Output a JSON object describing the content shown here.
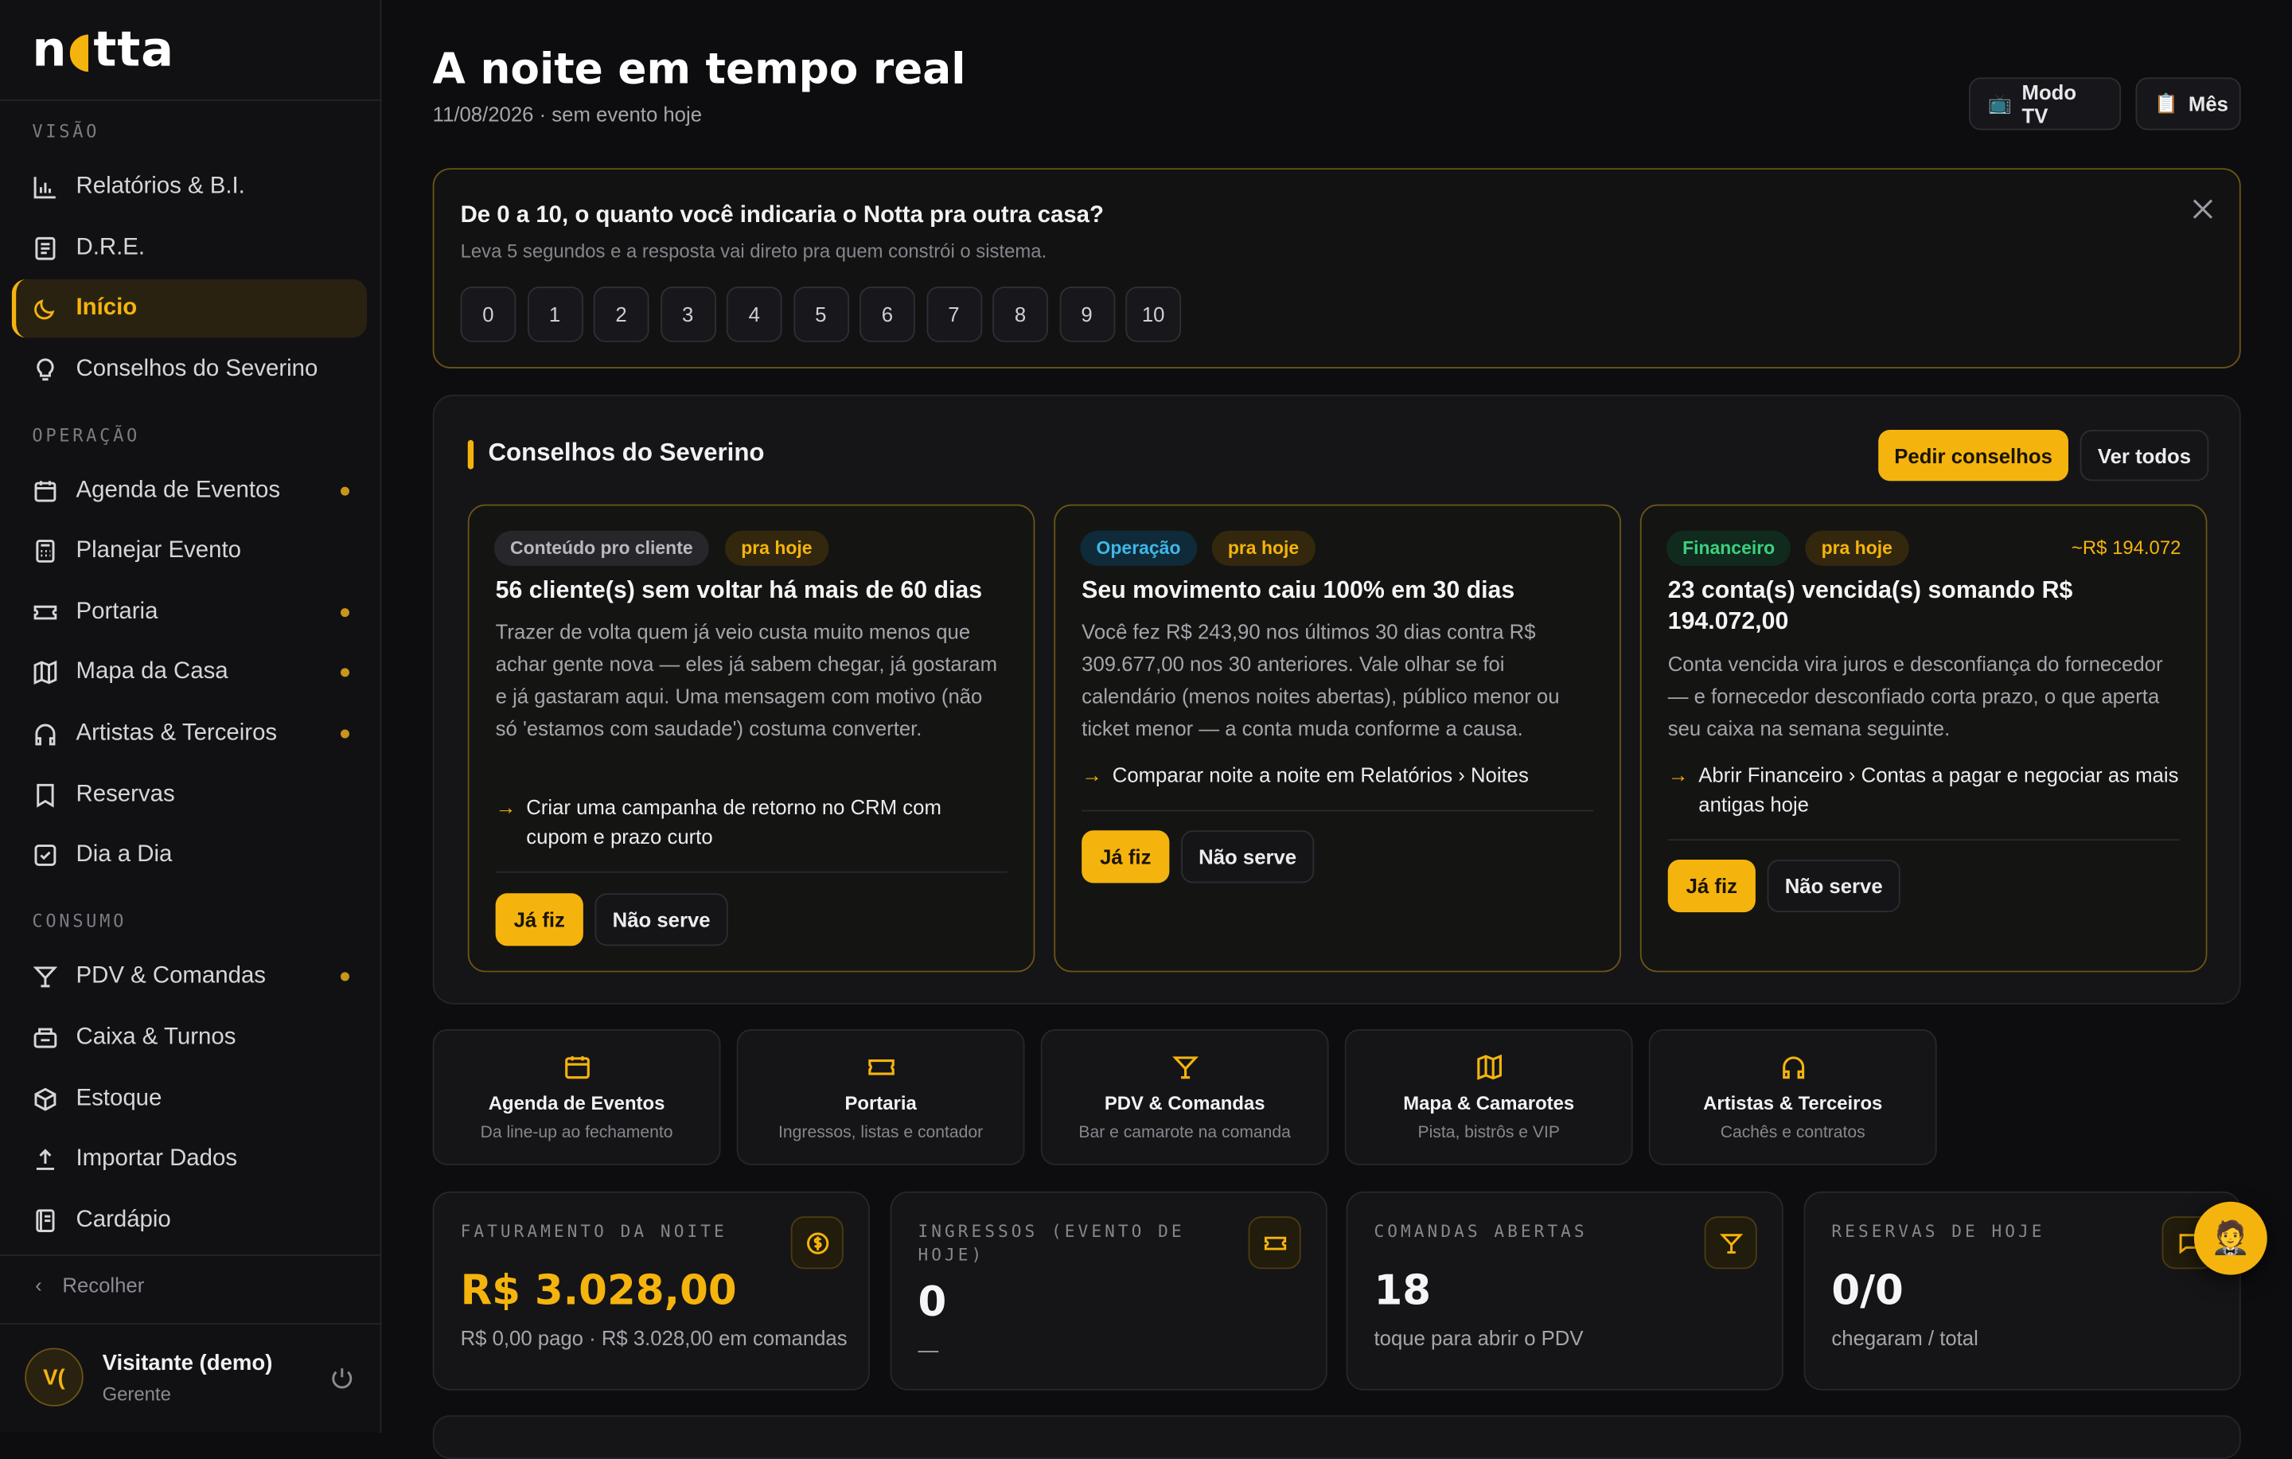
{
  "brand": {
    "logo_a": "n",
    "logo_moon": "●",
    "logo_b": "tta"
  },
  "sidebar": {
    "sections": {
      "visao": "VISÃO",
      "operacao": "OPERAÇÃO",
      "consumo": "CONSUMO"
    },
    "items": [
      {
        "label": "Relatórios & B.I.",
        "icon": "bar-chart-icon"
      },
      {
        "label": "D.R.E.",
        "icon": "document-icon"
      },
      {
        "label": "Início",
        "icon": "moon-icon",
        "active": true
      },
      {
        "label": "Conselhos do Severino",
        "icon": "lightbulb-icon"
      },
      {
        "label": "Agenda de Eventos",
        "icon": "calendar-icon",
        "dot": true
      },
      {
        "label": "Planejar Evento",
        "icon": "calculator-icon"
      },
      {
        "label": "Portaria",
        "icon": "ticket-icon",
        "dot": true
      },
      {
        "label": "Mapa da Casa",
        "icon": "map-icon",
        "dot": true
      },
      {
        "label": "Artistas & Terceiros",
        "icon": "headphones-icon",
        "dot": true
      },
      {
        "label": "Reservas",
        "icon": "bookmark-icon"
      },
      {
        "label": "Dia a Dia",
        "icon": "checkbox-icon"
      },
      {
        "label": "PDV & Comandas",
        "icon": "cocktail-icon",
        "dot": true
      },
      {
        "label": "Caixa & Turnos",
        "icon": "cash-register-icon"
      },
      {
        "label": "Estoque",
        "icon": "box-icon"
      },
      {
        "label": "Importar Dados",
        "icon": "upload-icon"
      },
      {
        "label": "Cardápio",
        "icon": "menu-book-icon"
      }
    ],
    "collapse_label": "Recolher",
    "user": {
      "initials": "V(",
      "name": "Visitante (demo)",
      "role": "Gerente"
    }
  },
  "header": {
    "title": "A noite em tempo real",
    "subtitle": "11/08/2026 · sem evento hoje",
    "btn_tv": "Modo TV",
    "btn_tv_icon": "📺",
    "btn_month": "Mês",
    "btn_month_icon": "📋"
  },
  "nps": {
    "question": "De 0 a 10, o quanto você indicaria o Notta pra outra casa?",
    "sub": "Leva 5 segundos e a resposta vai direto pra quem constrói o sistema.",
    "scores": [
      "0",
      "1",
      "2",
      "3",
      "4",
      "5",
      "6",
      "7",
      "8",
      "9",
      "10"
    ]
  },
  "advice": {
    "title": "Conselhos do Severino",
    "btn_ask": "Pedir conselhos",
    "btn_all": "Ver todos",
    "cards": [
      {
        "tag1": "Conteúdo pro cliente",
        "tag2": "pra hoje",
        "headline": "56 cliente(s) sem voltar há mais de 60 dias",
        "body": "Trazer de volta quem já veio custa muito menos que achar gente nova — eles já sabem chegar, já gostaram e já gastaram aqui. Uma mensagem com motivo (não só 'estamos com saudade') costuma converter.",
        "action": "Criar uma campanha de retorno no CRM com cupom e prazo curto",
        "done": "Já fiz",
        "dismiss": "Não serve"
      },
      {
        "tag1": "Operação",
        "tag2": "pra hoje",
        "headline": "Seu movimento caiu 100% em 30 dias",
        "body": "Você fez R$ 243,90 nos últimos 30 dias contra R$ 309.677,00 nos 30 anteriores. Vale olhar se foi calendário (menos noites abertas), público menor ou ticket menor — a conta muda conforme a causa.",
        "action": "Comparar noite a noite em Relatórios › Noites",
        "done": "Já fiz",
        "dismiss": "Não serve"
      },
      {
        "tag1": "Financeiro",
        "tag2": "pra hoje",
        "amount": "~R$ 194.072",
        "headline": "23 conta(s) vencida(s) somando R$ 194.072,00",
        "body": "Conta vencida vira juros e desconfiança do fornecedor — e fornecedor desconfiado corta prazo, o que aperta seu caixa na semana seguinte.",
        "action": "Abrir Financeiro › Contas a pagar e negociar as mais antigas hoje",
        "done": "Já fiz",
        "dismiss": "Não serve"
      }
    ]
  },
  "quick_links": [
    {
      "title": "Agenda de Eventos",
      "sub": "Da line-up ao fechamento",
      "icon": "calendar-icon"
    },
    {
      "title": "Portaria",
      "sub": "Ingressos, listas e contador",
      "icon": "ticket-icon"
    },
    {
      "title": "PDV & Comandas",
      "sub": "Bar e camarote na comanda",
      "icon": "cocktail-icon"
    },
    {
      "title": "Mapa & Camarotes",
      "sub": "Pista, bistrôs e VIP",
      "icon": "map-icon"
    },
    {
      "title": "Artistas & Terceiros",
      "sub": "Cachês e contratos",
      "icon": "headphones-icon"
    }
  ],
  "kpis": [
    {
      "label": "FATURAMENTO DA NOITE",
      "value": "R$ 3.028,00",
      "sub": "R$ 0,00 pago · R$ 3.028,00 em comandas",
      "icon": "dollar-icon"
    },
    {
      "label": "INGRESSOS (EVENTO DE HOJE)",
      "value": "0",
      "sub": "—",
      "icon": "ticket-icon"
    },
    {
      "label": "COMANDAS ABERTAS",
      "value": "18",
      "sub": "toque para abrir o PDV",
      "icon": "cocktail-icon"
    },
    {
      "label": "RESERVAS DE HOJE",
      "value": "0/0",
      "sub": "chegaram / total",
      "icon": "chat-icon"
    }
  ],
  "fab": {
    "icon": "assistant-icon",
    "glyph": "🤵"
  },
  "colors": {
    "accent": "#f5b40d",
    "background": "#0d0d10",
    "sidebar": "#111114"
  }
}
